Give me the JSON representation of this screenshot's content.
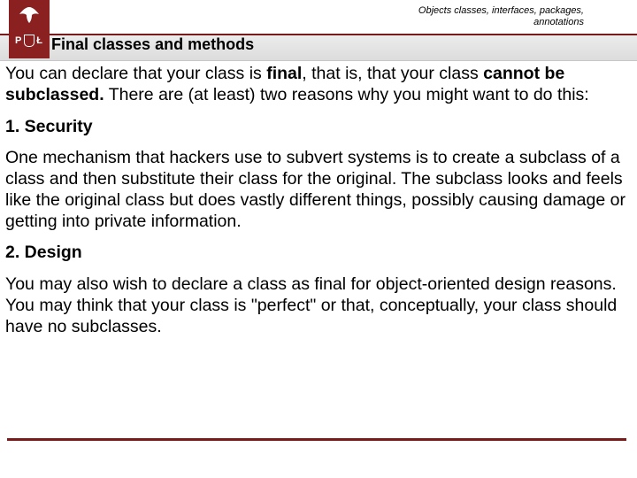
{
  "breadcrumb": {
    "line1": "Objects classes, interfaces, packages,",
    "line2": "annotations"
  },
  "logo": {
    "left_letter": "P",
    "right_letter": "Ł",
    "icon_name": "eagle-icon"
  },
  "title": "Final classes and methods",
  "body": {
    "intro_pre": "You can declare that your class is ",
    "intro_bold1": "final",
    "intro_mid": ", that is, that your class ",
    "intro_bold2": "cannot be subclassed.",
    "intro_post": " There are (at least) two reasons why you might want to do this:",
    "h1": "1. Security",
    "p1": "One mechanism that hackers use to subvert systems is to create a subclass of a class and then substitute their class for the original. The subclass looks and feels like the original class but does vastly different things, possibly causing damage or getting into private information.",
    "h2": "2. Design",
    "p2": "You may also wish to declare a class as final for object-oriented design reasons. You may think that your class is \"perfect\" or that, conceptually, your class should have no subclasses."
  }
}
